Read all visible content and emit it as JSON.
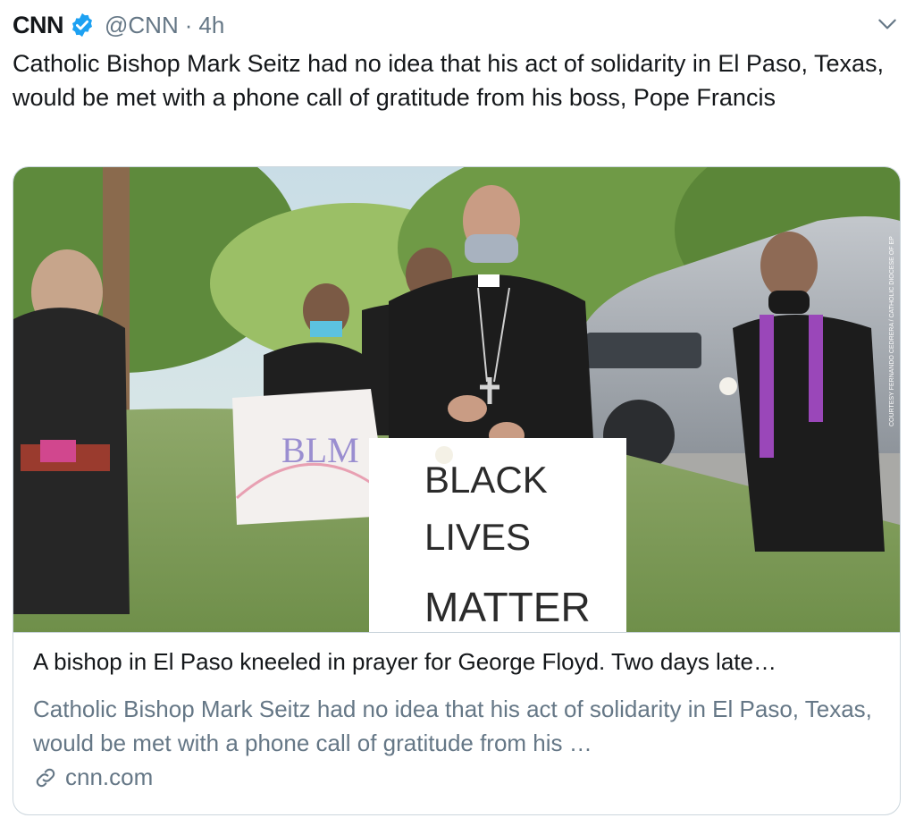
{
  "tweet": {
    "author_name": "CNN",
    "handle": "@CNN",
    "separator": "·",
    "time": "4h",
    "text": "Catholic Bishop Mark Seitz had no idea that his act of solidarity in El Paso, Texas, would be met with a phone call of gratitude from his boss, Pope Francis",
    "verified_icon": "verified-badge-icon",
    "menu_icon": "chevron-down-icon"
  },
  "card": {
    "title": "A bishop in El Paso kneeled in prayer for George Floyd. Two days late…",
    "description": "Catholic Bishop Mark Seitz had no idea that his act of solidarity in El Paso, Texas, would be met with a phone call of gratitude from his …",
    "domain": "cnn.com",
    "link_icon": "link-icon",
    "photo": {
      "sign_front_line1": "BLACK",
      "sign_front_line2": "LIVES",
      "sign_front_line3": "MATTER",
      "sign_back": "BLM",
      "photo_credit": "COURTESY FERNANDO CEDRERA / CATHOLIC DIOCESE OF EP"
    }
  },
  "colors": {
    "brand_blue": "#1da1f2",
    "secondary_text": "#657786",
    "border": "#ccd6dd"
  }
}
